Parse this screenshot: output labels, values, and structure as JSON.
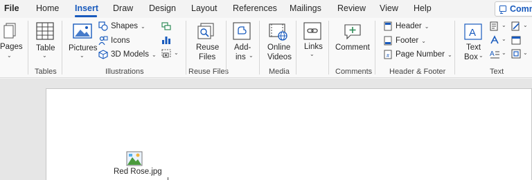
{
  "tabs": {
    "file": "File",
    "home": "Home",
    "insert": "Insert",
    "draw": "Draw",
    "design": "Design",
    "layout": "Layout",
    "references": "References",
    "mailings": "Mailings",
    "review": "Review",
    "view": "View",
    "help": "Help"
  },
  "comments_button": "Comm",
  "groups": {
    "pages": {
      "button": "Pages"
    },
    "tables": {
      "label": "Tables",
      "button": "Table"
    },
    "illustrations": {
      "label": "Illustrations",
      "pictures": "Pictures",
      "shapes": "Shapes",
      "icons": "Icons",
      "models": "3D Models"
    },
    "reuse": {
      "label": "Reuse Files",
      "button_line1": "Reuse",
      "button_line2": "Files"
    },
    "addins": {
      "line1": "Add-",
      "line2": "ins"
    },
    "media": {
      "label": "Media",
      "line1": "Online",
      "line2": "Videos"
    },
    "links": {
      "button": "Links"
    },
    "comments": {
      "label": "Comments",
      "button": "Comment"
    },
    "header_footer": {
      "label": "Header & Footer",
      "header": "Header",
      "footer": "Footer",
      "page_number": "Page Number"
    },
    "text": {
      "label": "Text",
      "line1": "Text",
      "line2": "Box"
    }
  },
  "document": {
    "attachment_name": "Red Rose.jpg"
  },
  "colors": {
    "accent": "#185abd",
    "ribbon_bg": "#f9f9f9",
    "canvas_bg": "#e6e6e6"
  }
}
